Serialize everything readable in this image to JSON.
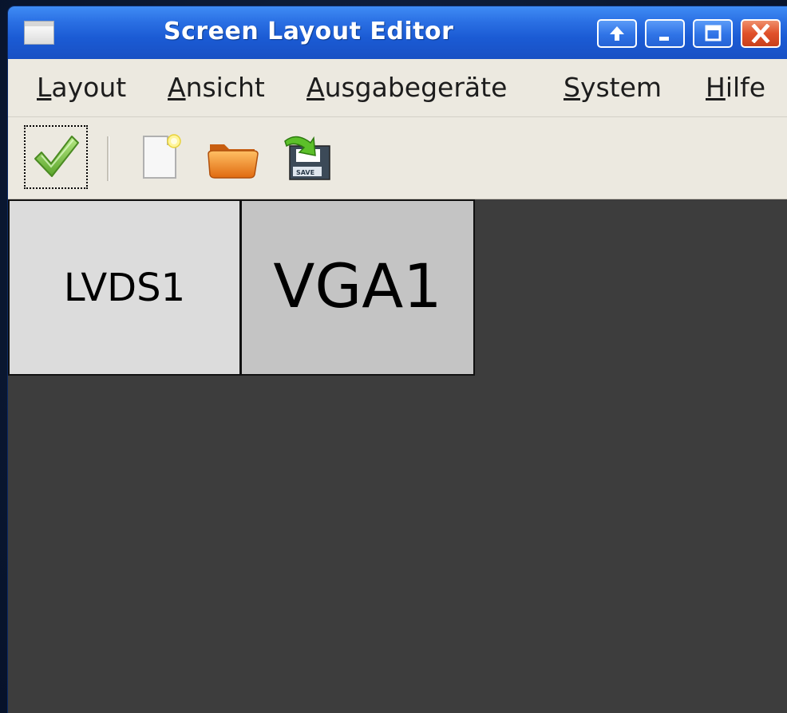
{
  "window": {
    "title": "Screen Layout Editor",
    "titlebar_color": "#1f5fd6",
    "buttons": [
      {
        "icon": "rollup-icon",
        "glyph": "↑"
      },
      {
        "icon": "minimize-icon",
        "glyph": "_"
      },
      {
        "icon": "maximize-icon",
        "glyph": "□"
      },
      {
        "icon": "close-icon",
        "glyph": "X"
      }
    ]
  },
  "menubar": {
    "items": [
      {
        "mnemonic": "L",
        "rest": "ayout"
      },
      {
        "mnemonic": "A",
        "rest": "nsicht"
      },
      {
        "mnemonic": "A",
        "rest": "usgabegeräte"
      },
      {
        "mnemonic": "S",
        "rest": "ystem"
      },
      {
        "mnemonic": "H",
        "rest": "ilfe"
      }
    ]
  },
  "toolbar": {
    "items": [
      {
        "icon": "apply-checkmark-icon"
      },
      {
        "icon": "new-document-icon"
      },
      {
        "icon": "open-folder-icon"
      },
      {
        "icon": "save-as-icon"
      }
    ]
  },
  "canvas": {
    "background": "#3d3d3d",
    "monitors": [
      {
        "label": "LVDS1",
        "color": "#dcdcdc"
      },
      {
        "label": "VGA1",
        "color": "#c4c4c4"
      }
    ]
  }
}
